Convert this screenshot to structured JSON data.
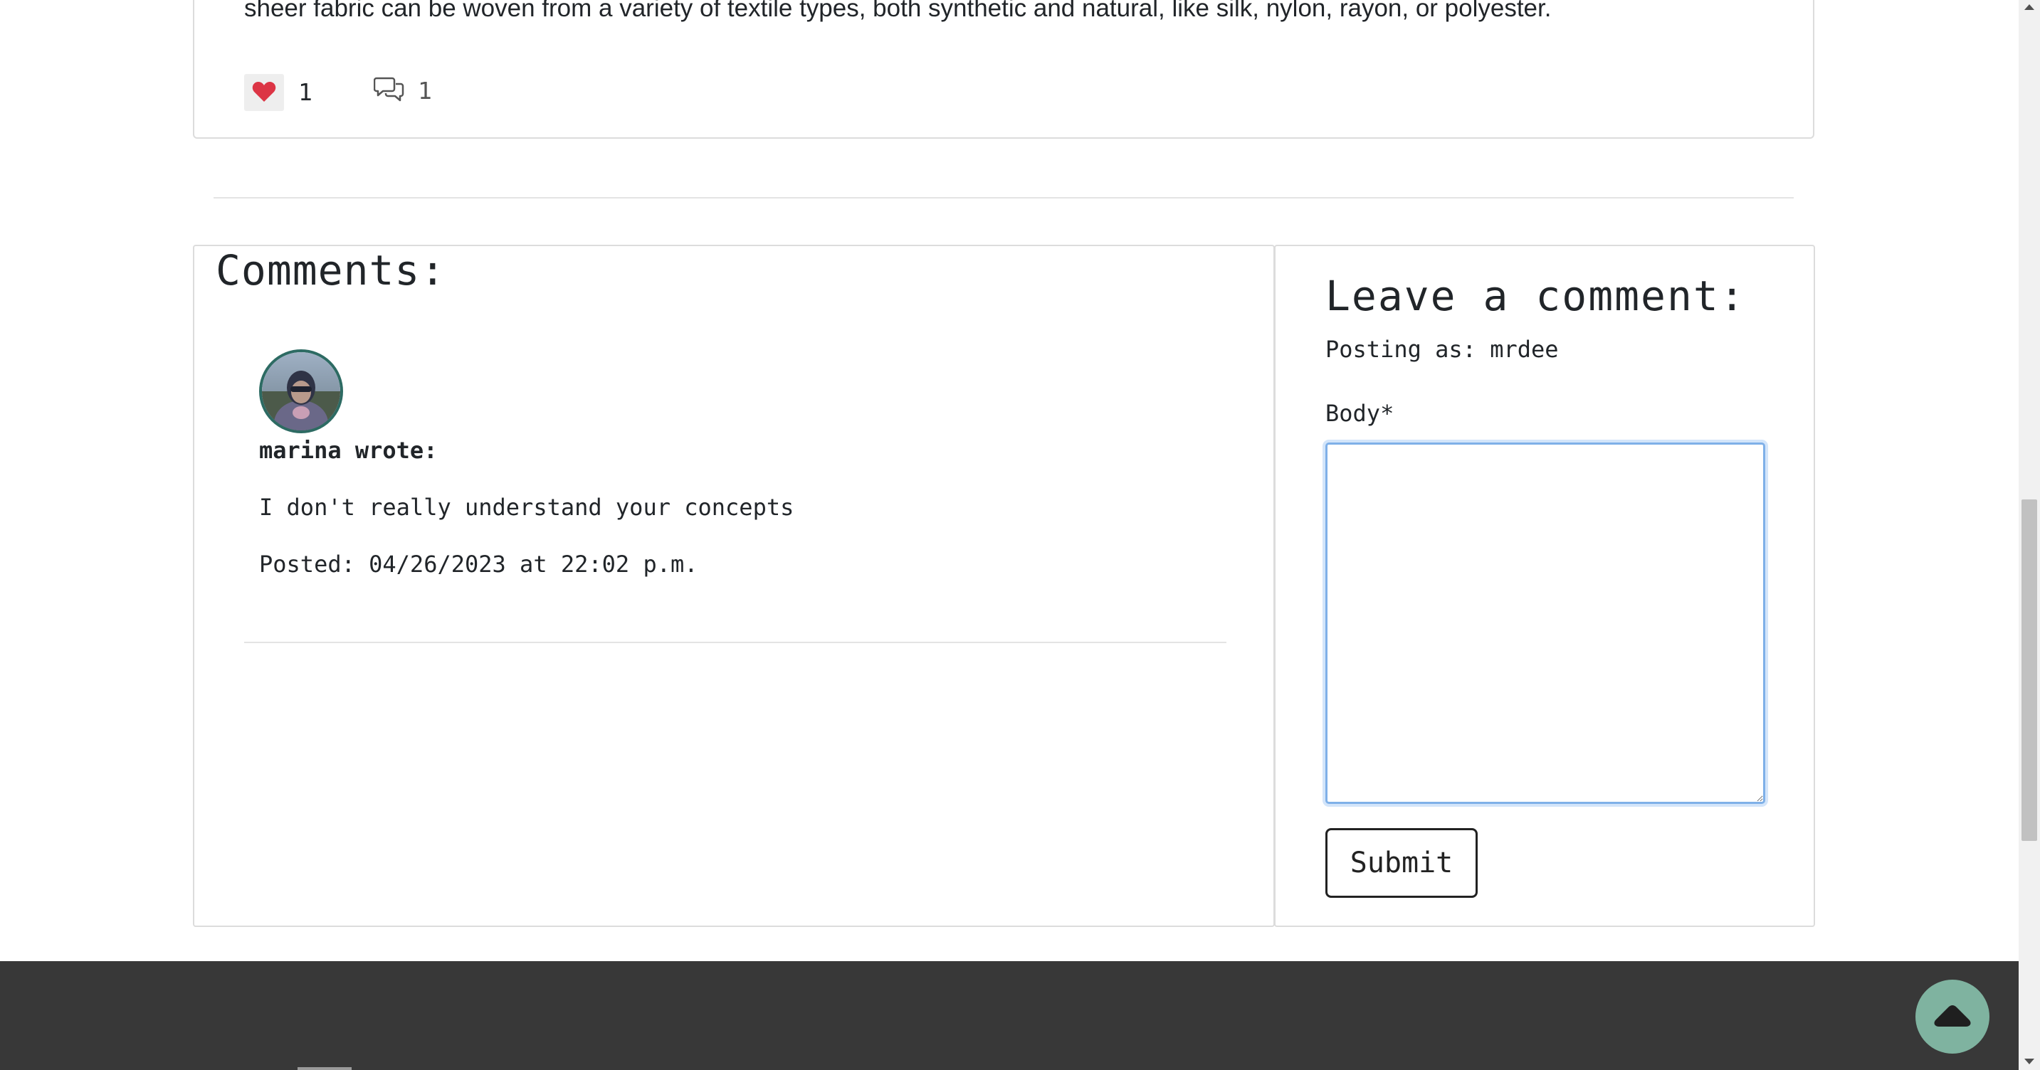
{
  "post": {
    "excerpt": "sheer fabric can be woven from a variety of textile types, both synthetic and natural, like silk, nylon, rayon, or polyester.",
    "likes": "1",
    "comments_count": "1",
    "like_icon": "heart-icon",
    "comment_icon": "chat-bubbles-icon"
  },
  "comments": {
    "heading": "Comments:",
    "items": [
      {
        "author": "marina wrote:",
        "body": "I don't really understand your concepts",
        "date": "Posted: 04/26/2023 at 22:02 p.m.",
        "avatar_icon": "avatar-photo"
      }
    ]
  },
  "form": {
    "heading": "Leave a comment:",
    "posting_as": "Posting as: mrdee",
    "body_label": "Body*",
    "body_value": "",
    "submit_label": "Submit"
  },
  "footer": {
    "scroll_top_icon": "caret-up-icon"
  },
  "colors": {
    "heart": "#dc3545",
    "avatar_border": "#2d6b63",
    "footer_bg": "#383838",
    "scroll_top_bg": "#7fb3a0",
    "textarea_focus": "#7fb0e8"
  }
}
